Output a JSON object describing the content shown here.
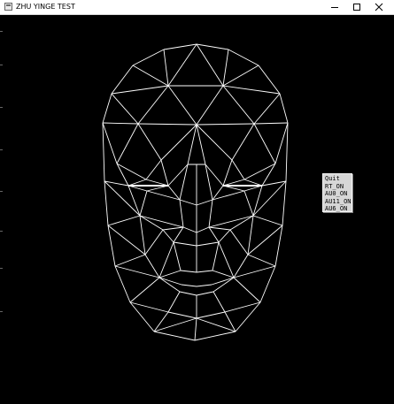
{
  "window": {
    "title": "ZHU YINGE TEST",
    "controls": [
      "minimize",
      "maximize",
      "close"
    ]
  },
  "colors": {
    "background": "#000000",
    "wireframe": "#ffffff",
    "menu_background": "#d7d7d7"
  },
  "menu": {
    "items": [
      "Quit",
      "RT_ON",
      "AU0_ON",
      "AU11_ON",
      "AU6_ON"
    ]
  }
}
